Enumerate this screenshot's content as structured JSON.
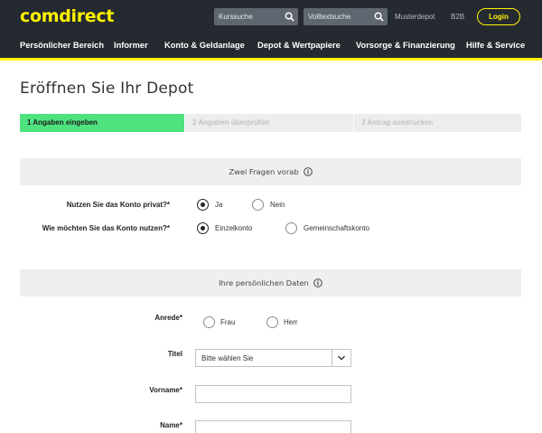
{
  "header": {
    "logo": "comdirect",
    "search_kurs_placeholder": "Kurssuche",
    "search_volltext_placeholder": "Volltextsuche",
    "musterdepot": "Musterdepot",
    "b2b": "B2B",
    "login": "Login",
    "nav": [
      {
        "label": "Persönlicher Bereich"
      },
      {
        "label": "Informer"
      },
      {
        "label": "Konto & Geldanlage"
      },
      {
        "label": "Depot & Wertpapiere"
      },
      {
        "label": "Vorsorge & Finanzierung"
      },
      {
        "label": "Hilfe & Service"
      }
    ],
    "accent_color": "#fff200",
    "bar_color": "#252a31"
  },
  "page": {
    "title": "Eröffnen Sie Ihr Depot"
  },
  "steps": [
    {
      "label": "1 Angaben eingeben",
      "state": "active"
    },
    {
      "label": "2 Angaben überprüfen",
      "state": "inactive"
    },
    {
      "label": "3 Antrag ausdrucken",
      "state": "inactive"
    }
  ],
  "section_questions": {
    "heading": "Zwei Fragen vorab",
    "q1": {
      "label": "Nutzen Sie das Konto privat?*",
      "options": [
        {
          "label": "Ja",
          "checked": true
        },
        {
          "label": "Nein",
          "checked": false
        }
      ]
    },
    "q2": {
      "label": "Wie möchten Sie das Konto nutzen?*",
      "options": [
        {
          "label": "Einzelkonto",
          "checked": true
        },
        {
          "label": "Gemeinschaftskonto",
          "checked": false
        }
      ]
    }
  },
  "section_personal": {
    "heading": "Ihre persönlichen Daten",
    "anrede": {
      "label": "Anrede*",
      "options": [
        {
          "label": "Frau",
          "checked": false
        },
        {
          "label": "Herr",
          "checked": false
        }
      ]
    },
    "titel": {
      "label": "Titel",
      "selected": "Bitte wählen Sie"
    },
    "vorname": {
      "label": "Vorname*",
      "value": ""
    },
    "name": {
      "label": "Name*",
      "value": ""
    }
  }
}
